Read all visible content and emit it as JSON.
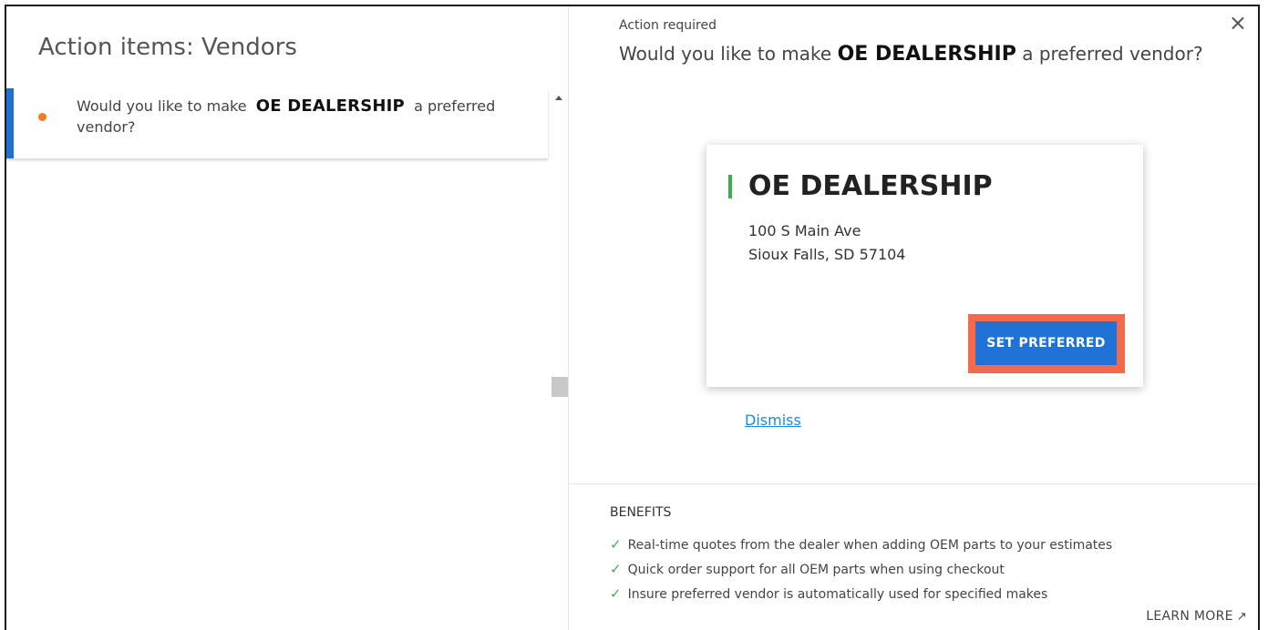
{
  "left": {
    "title": "Action items: Vendors",
    "items": [
      {
        "text_before": "Would you like to make",
        "vendor": "OE DEALERSHIP",
        "text_after": "a preferred vendor?"
      }
    ]
  },
  "detail": {
    "label": "Action required",
    "question_before": "Would you like to make",
    "question_vendor": "OE DEALERSHIP",
    "question_after": "a preferred vendor?",
    "close_icon": "×",
    "card": {
      "name": "OE DEALERSHIP",
      "address_line1": "100 S Main Ave",
      "address_line2": "Sioux Falls, SD 57104",
      "button_label": "SET PREFERRED"
    },
    "dismiss_label": "Dismiss"
  },
  "benefits": {
    "title": "BENEFITS",
    "check_icon": "✓",
    "items": [
      "Real-time quotes from the dealer when adding OEM parts to your estimates",
      "Quick order support for all OEM parts when using checkout",
      "Insure preferred vendor is automatically used for specified makes"
    ],
    "learn_more": "LEARN MORE",
    "external_icon": "↗"
  },
  "colors": {
    "accent_blue": "#1f72d6",
    "status_orange": "#f47b20",
    "highlight": "#f26a4b",
    "vendor_green": "#3cae4f",
    "link": "#1e8bd8"
  }
}
